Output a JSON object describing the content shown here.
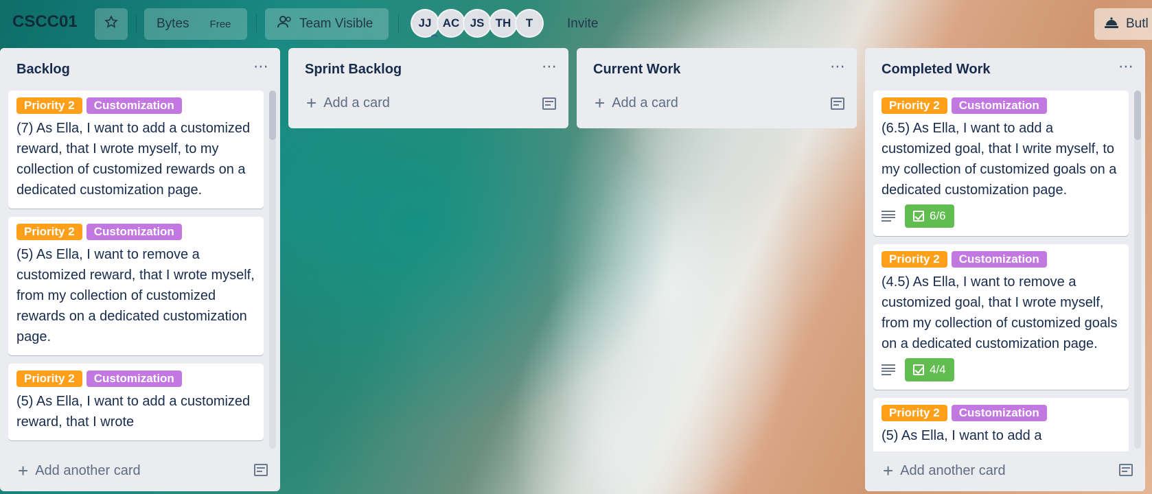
{
  "header": {
    "board_title": "CSCC01",
    "workspace": "Bytes",
    "plan": "Free",
    "visibility": "Team Visible",
    "members": [
      "JJ",
      "AC",
      "JS",
      "TH",
      "T"
    ],
    "invite": "Invite",
    "butler": "Butl"
  },
  "lists": [
    {
      "title": "Backlog",
      "footer": "Add another card",
      "cards": [
        {
          "labels": [
            "Priority 2",
            "Customization"
          ],
          "text": "(7) As Ella, I want to add a customized reward, that I wrote myself, to my collection of customized rewards on a dedicated customization page."
        },
        {
          "labels": [
            "Priority 2",
            "Customization"
          ],
          "text": "(5) As Ella, I want to remove a customized reward, that I wrote myself, from my collection of customized rewards on a dedicated customization page."
        },
        {
          "labels": [
            "Priority 2",
            "Customization"
          ],
          "text": "(5) As Ella, I want to add a customized reward, that I wrote"
        }
      ]
    },
    {
      "title": "Sprint Backlog",
      "add_card": "Add a card"
    },
    {
      "title": "Current Work",
      "add_card": "Add a card"
    },
    {
      "title": "Completed Work",
      "footer": "Add another card",
      "cards": [
        {
          "labels": [
            "Priority 2",
            "Customization"
          ],
          "text": "(6.5) As Ella, I want to add a customized goal, that I write myself, to my collection of customized goals on a dedicated customization page.",
          "checklist": "6/6"
        },
        {
          "labels": [
            "Priority 2",
            "Customization"
          ],
          "text": "(4.5) As Ella, I want to remove a customized goal, that I wrote myself, from my collection of customized goals on a dedicated customization page.",
          "checklist": "4/4"
        },
        {
          "labels": [
            "Priority 2",
            "Customization"
          ],
          "text": "(5) As Ella, I want to add a"
        }
      ]
    }
  ],
  "colors": {
    "label_orange": "#ff9f1a",
    "label_purple": "#c377e0",
    "checklist_green": "#61bd4f"
  }
}
